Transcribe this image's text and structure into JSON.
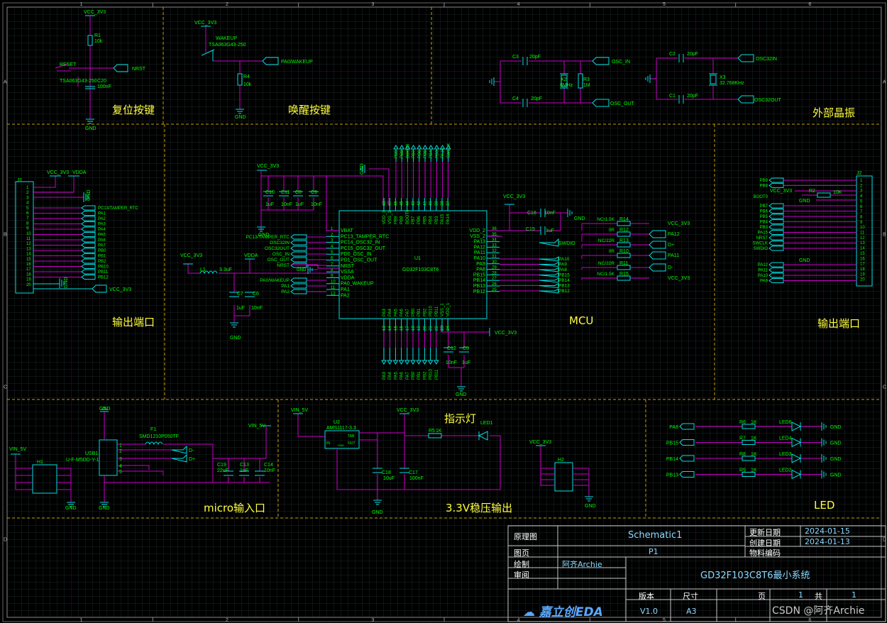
{
  "colors": {
    "background": "#000000",
    "grid": "#1f2a2a",
    "wire": "#cc00cc",
    "component": "#00e0e0",
    "net_label": "#00ff00",
    "section_label": "#ffff3c",
    "divider": "#c8a000"
  },
  "border": {
    "cols": [
      "1",
      "2",
      "3",
      "4",
      "5",
      "6"
    ],
    "rows": [
      "A",
      "B",
      "C",
      "D"
    ]
  },
  "sections": {
    "reset": "复位按键",
    "wakeup": "唤醒按键",
    "crystal": "外部晶振",
    "out_left": "输出端口",
    "mcu": "MCU",
    "out_right": "输出端口",
    "usb": "micro输入口",
    "indicator": "指示灯",
    "ldo": "3.3V稳压输出",
    "led": "LED"
  },
  "reset": {
    "vcc": "VCC_3V3",
    "r1": "R1",
    "r1_val": "10k",
    "sw_ref": "RESET",
    "sw_part": "TSA063G43-250",
    "c20": "C20",
    "c20_val": "100nF",
    "net": "NRST",
    "gnd": "GND"
  },
  "wakeup": {
    "vcc": "VCC_3V3",
    "sw_ref": "WAKEUP",
    "sw_part": "TSA063G43-250",
    "net": "PA0/WAKEUP",
    "r4": "R4",
    "r4_val": "10k",
    "gnd": "GND"
  },
  "crystal": {
    "c3": "C3",
    "c3_val": "20pF",
    "c4": "C4",
    "c4_val": "20pF",
    "x2": "X2",
    "x2_val": "8MHz",
    "r3": "R3",
    "r3_val": "1M",
    "osc_in": "OSC_IN",
    "osc_out": "OSC_OUT",
    "c2": "C2",
    "c2_val": "20pF",
    "c1": "C1",
    "c1_val": "20pF",
    "x3": "X3",
    "x3_val": "32.768KHz",
    "osc32_in": "OSC32IN",
    "osc32_out": "OSC32OUT"
  },
  "j1": {
    "ref": "J1",
    "vcc": "VCC_3V3",
    "vdda": "VDDA",
    "gnd": "GND",
    "gnd2": "GND",
    "vcc_bottom": "VCC_3V3",
    "pins": [
      "1",
      "2",
      "3",
      "4",
      "5",
      "6",
      "7",
      "8",
      "9",
      "10",
      "11",
      "12",
      "13",
      "14",
      "15",
      "16",
      "17",
      "18",
      "19",
      "20"
    ],
    "nets": [
      "PC13/TAMPER_RTC",
      "PA1",
      "PA2",
      "PA3",
      "PA4",
      "PA5",
      "PA6",
      "PA7",
      "PB0",
      "PB1",
      "PB2",
      "PB10",
      "PB11",
      "PB12"
    ]
  },
  "mcu": {
    "ref": "U1",
    "part": "GD32F103C8T6",
    "vcc": "VCC_3V3",
    "gnd": "GND",
    "caps": [
      {
        "ref": "C10",
        "val": "1uF"
      },
      {
        "ref": "C11",
        "val": "10nF"
      },
      {
        "ref": "C8",
        "val": "1uF"
      },
      {
        "ref": "C9",
        "val": "10nF"
      }
    ],
    "l1": "L1",
    "l1_val": "3.3uF",
    "c7": "C7",
    "c7_val": "1uF",
    "c6": "C6",
    "c6_val": "10nF",
    "vdda": "VDDA",
    "left_nets": [
      "PC13/TAMPER_RTC",
      "OSC32IN",
      "OSC32OUT",
      "OSC_IN",
      "OSC_OUT",
      "NRST",
      "GND",
      "PA0/WAKEUP",
      "PA1",
      "PA2"
    ],
    "left_pins": [
      "1",
      "2",
      "3",
      "4",
      "5",
      "6",
      "7",
      "8",
      "9",
      "10",
      "11",
      "12"
    ],
    "left_names": [
      "VBAT",
      "PC13_TAMPER_RTC",
      "PC14_OSC32_IN",
      "PC15_OSC32_OUT",
      "PD0_OSC_IN",
      "PD1_OSC_OUT",
      "NRST",
      "VSSA",
      "VDDA",
      "PA0_WAKEUP",
      "PA1",
      "PA2"
    ],
    "top_nets": [
      "PB9",
      "PB8",
      "BOOT0",
      "PB7",
      "PB6",
      "PB5",
      "PB4",
      "PB3",
      "PA15",
      "SWCLK"
    ],
    "top_pins": [
      "48",
      "47",
      "46",
      "45",
      "44",
      "43",
      "42",
      "41",
      "40",
      "39",
      "38",
      "37"
    ],
    "top_names": [
      "VDD_3",
      "VSS_3",
      "PB9",
      "PB8",
      "BOOT0",
      "PB7",
      "PB6",
      "PB5",
      "PB4",
      "PB3",
      "PA15",
      "PA14"
    ],
    "right_pins": [
      "36",
      "35",
      "34",
      "33",
      "32",
      "31",
      "30",
      "29",
      "28",
      "27",
      "26",
      "25"
    ],
    "right_names": [
      "VDD_2",
      "VSS_2",
      "PA13",
      "PA12",
      "PA11",
      "PA10",
      "PA9",
      "PA8",
      "PB15",
      "PB14",
      "PB13",
      "PB12"
    ],
    "right_nets": [
      "SWDIO",
      "PA10",
      "PA9",
      "PA8",
      "PB15",
      "PB14",
      "PB13",
      "PB12"
    ],
    "right_vcc": "VCC_3V3",
    "c16": "C16",
    "c16_val": "10nF",
    "c15": "C15",
    "c15_val": "1uF",
    "resistors": [
      {
        "ref": "R14",
        "val": "NC/1.5K",
        "net": "VCC_3V3"
      },
      {
        "ref": "R12",
        "val": "0R",
        "net": "PA12"
      },
      {
        "ref": "R13",
        "val": "NC/22R",
        "net": "D+"
      },
      {
        "ref": "R10",
        "val": "0R",
        "net": "PA11"
      },
      {
        "ref": "R11",
        "val": "NC/22R",
        "net": "D-"
      },
      {
        "ref": "R15",
        "val": "NC/1.5K",
        "net": "VCC_3V3"
      }
    ],
    "bottom_pins": [
      "13",
      "14",
      "15",
      "16",
      "17",
      "18",
      "19",
      "20",
      "21",
      "22",
      "23",
      "24"
    ],
    "bottom_names": [
      "PA3",
      "PA4",
      "PA5",
      "PA6",
      "PA7",
      "PB0",
      "PB1",
      "PB2",
      "PB10",
      "PB11",
      "VSS_1",
      "VDD_1"
    ],
    "bottom_nets": [
      "PA3",
      "PA4",
      "PA5",
      "PA6",
      "PA7",
      "PB0",
      "PB1",
      "PB2",
      "PB10",
      "PB11"
    ],
    "bottom_vcc": "VCC_3V3",
    "c12": "C12",
    "c12_val": "10nF",
    "c5": "C5",
    "c5_val": "1uF"
  },
  "j2": {
    "ref": "J2",
    "pins": [
      "1",
      "2",
      "3",
      "4",
      "5",
      "6",
      "7",
      "8",
      "9",
      "10",
      "11",
      "12",
      "13",
      "14",
      "15",
      "16",
      "17",
      "18",
      "19",
      "20"
    ],
    "nets_top": [
      "PB9",
      "PB8"
    ],
    "boot": "BOOT0",
    "vcc": "VCC_3V3",
    "r2": "R2",
    "r2_val": "10K",
    "gnd": "GND",
    "nets_mid": [
      "PB7",
      "PB6",
      "PB5",
      "PB4",
      "PB3",
      "PA15",
      "NRST",
      "SWCLK",
      "SWDIO"
    ],
    "gnd2": "GND",
    "nets_bot": [
      "PA12",
      "PA11",
      "PA10",
      "PA9"
    ]
  },
  "usb": {
    "ref": "USB1",
    "part": "U-F-M5DD-Y-1",
    "gnd_top": "GND",
    "f1": "F1",
    "f1_part": "SMD1210P050TF",
    "dm": "D-",
    "dp": "D+",
    "pins": [
      "1",
      "2",
      "3",
      "4",
      "5"
    ],
    "vin": "VIN_5V",
    "vin2": "VIN_5V",
    "c19": "C19",
    "c19_val": "22uF",
    "c13": "C13",
    "c13_val": "1uF",
    "c14": "C14",
    "c14_val": "10nF",
    "h1": "H1",
    "gnd": "GND",
    "gnd2": "GND"
  },
  "ldo": {
    "vin": "VIN_5V",
    "u2": "U2",
    "u2_part": "AMS1117-3.3",
    "vcc": "VCC_3V3",
    "pin_tab": "TAB",
    "pin_in": "IN",
    "pin_out": "OUT",
    "pin_gnd": "GND",
    "c18": "C18",
    "c18_val": "10uF",
    "c17": "C17",
    "c17_val": "100nF",
    "gnd": "GND",
    "r5": "R5",
    "r5_val": "1K",
    "led1": "LED1"
  },
  "h2": {
    "ref": "H2",
    "vcc": "VCC_3V3",
    "gnd": "GND"
  },
  "leds": [
    {
      "net": "PA8",
      "r": "R6",
      "rv": "1K",
      "led": "LED6",
      "gnd": "GND"
    },
    {
      "net": "PB15",
      "r": "R7",
      "rv": "1K",
      "led": "LED4",
      "gnd": "GND"
    },
    {
      "net": "PB14",
      "r": "R8",
      "rv": "1K",
      "led": "LED3",
      "gnd": "GND"
    },
    {
      "net": "PB13",
      "r": "R9",
      "rv": "1K",
      "led": "LED2",
      "gnd": "GND"
    }
  ],
  "titleblock": {
    "lbl_schematic": "原理图",
    "val_schematic": "Schematic1",
    "lbl_page": "图页",
    "val_page": "P1",
    "lbl_draw": "绘制",
    "val_draw": "阿齐Archie",
    "lbl_review": "审阅",
    "lbl_updated": "更新日期",
    "val_updated": "2024-01-15",
    "lbl_created": "创建日期",
    "val_created": "2024-01-13",
    "lbl_material": "物料编码",
    "project": "GD32F103C8T6最小系统",
    "lbl_version": "版本",
    "lbl_size": "尺寸",
    "lbl_pageno": "页",
    "val_pageno": "1",
    "lbl_total": "共",
    "val_total": "1",
    "val_version": "V1.0",
    "val_size": "A3",
    "logo": "嘉立创EDA",
    "watermark": "CSDN @阿齐Archie"
  }
}
